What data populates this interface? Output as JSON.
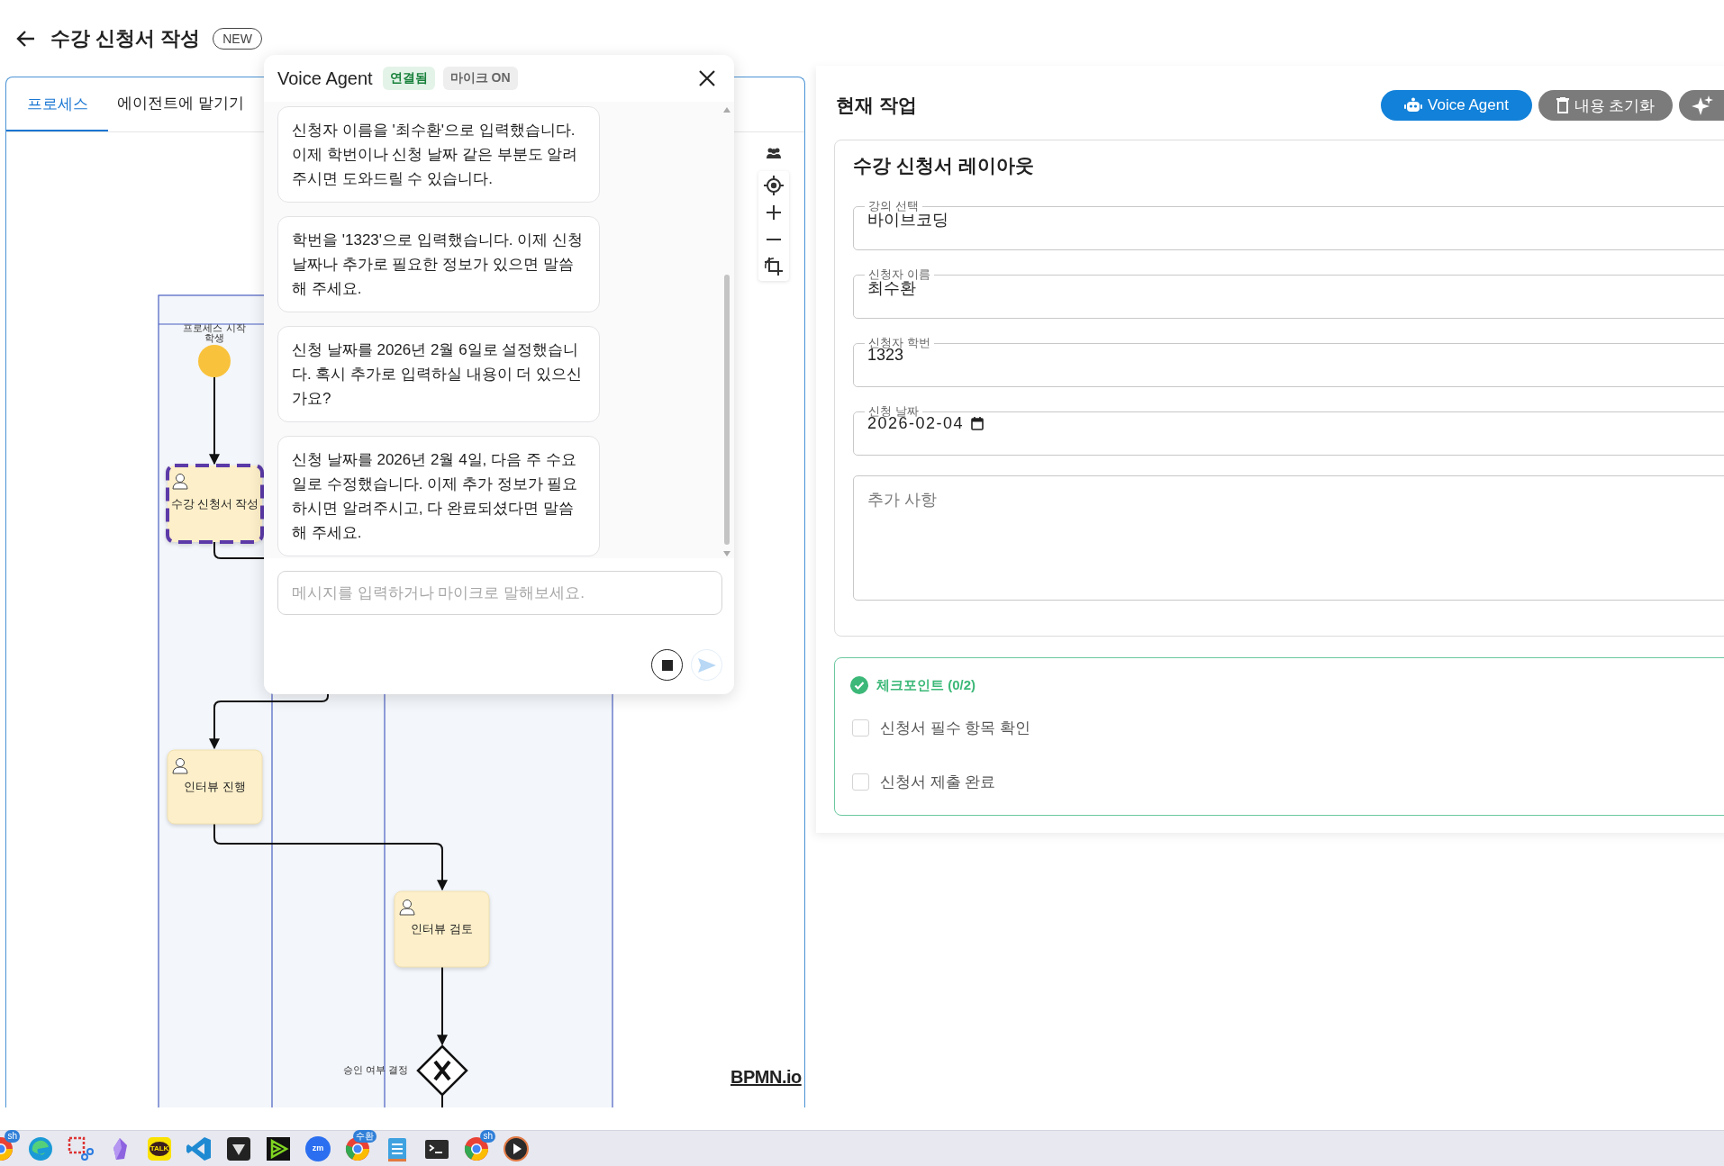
{
  "header": {
    "title": "수강 신청서 작성",
    "badge": "NEW"
  },
  "tabs": [
    {
      "label": "프로세스",
      "selected": true
    },
    {
      "label": "에이전트에 맡기기",
      "selected": false
    }
  ],
  "diagram": {
    "lane_label": "학생",
    "logo": "BPMN.io",
    "nodes": [
      {
        "kind": "start",
        "label": "프로세스 시작"
      },
      {
        "kind": "task",
        "label": "수강 신청서 작성",
        "selected": true
      },
      {
        "kind": "task",
        "label": "인터뷰 진행",
        "selected": false
      },
      {
        "kind": "task",
        "label": "인터뷰 검토",
        "selected": false
      },
      {
        "kind": "gateway",
        "label": "승인 여부 결정"
      }
    ]
  },
  "voice_agent": {
    "title": "Voice Agent",
    "status": "연결됨",
    "mic": "마이크 ON",
    "messages": [
      "신청자 이름을 '최수환'으로 입력했습니다. 이제 학번이나 신청 날짜 같은 부분도 알려주시면 도와드릴 수 있습니다.",
      "학번을 '1323'으로 입력했습니다. 이제 신청 날짜나 추가로 필요한 정보가 있으면 말씀해 주세요.",
      "신청 날짜를 2026년 2월 6일로 설정했습니다. 혹시 추가로 입력하실 내용이 더 있으신가요?",
      "신청 날짜를 2026년 2월 4일, 다음 주 수요일로 수정했습니다. 이제 추가 정보가 필요하시면 알려주시고, 다 완료되셨다면 말씀해 주세요."
    ],
    "input": {
      "placeholder": "메시지를 입력하거나 마이크로 말해보세요."
    }
  },
  "current_task": {
    "title": "현재 작업",
    "buttons": [
      {
        "kind": "voice",
        "label": "Voice Agent"
      },
      {
        "kind": "reset",
        "label": "내용 초기화"
      },
      {
        "kind": "magic"
      }
    ]
  },
  "form": {
    "title": "수강 신청서 레이아웃",
    "fields": [
      {
        "kind": "text",
        "label": "강의 선택",
        "value": "바이브코딩"
      },
      {
        "kind": "text",
        "label": "신청자 이름",
        "value": "최수환"
      },
      {
        "kind": "text",
        "label": "신청자 학번",
        "value": "1323"
      },
      {
        "kind": "date",
        "label": "신청 날짜",
        "value": "2026-02-04"
      },
      {
        "kind": "textarea",
        "placeholder": "추가 사항"
      }
    ]
  },
  "checkpoints": {
    "title": "체크포인트 (0/2)",
    "items": [
      {
        "label": "신청서 필수 항목 확인",
        "checked": false
      },
      {
        "label": "신청서 제출 완료",
        "checked": false
      }
    ]
  },
  "taskbar": [
    {
      "kind": "browser",
      "badge": "sh"
    },
    {
      "kind": "globe"
    },
    {
      "kind": "snip"
    },
    {
      "kind": "crystal"
    },
    {
      "kind": "chat",
      "label": "TALK"
    },
    {
      "kind": "code"
    },
    {
      "kind": "cube"
    },
    {
      "kind": "media"
    },
    {
      "kind": "meet",
      "label": "zm"
    },
    {
      "kind": "browser",
      "badge": "수환"
    },
    {
      "kind": "notes"
    },
    {
      "kind": "terminal"
    },
    {
      "kind": "browser",
      "badge": "sh"
    },
    {
      "kind": "player"
    }
  ]
}
